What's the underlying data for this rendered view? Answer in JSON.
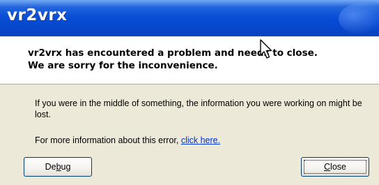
{
  "window": {
    "title": "vr2vrx"
  },
  "header": {
    "line1": "vr2vrx has encountered a problem and needs to close.",
    "line2": "We are sorry for the inconvenience."
  },
  "body": {
    "paragraph1": "If you were in the middle of something, the information you were working on might be lost.",
    "paragraph2_prefix": "For more information about this error, ",
    "paragraph2_link": "click here."
  },
  "buttons": {
    "debug_label_pre": "De",
    "debug_label_u": "b",
    "debug_label_post": "ug",
    "close_label_u": "C",
    "close_label_post": "lose"
  },
  "colors": {
    "titlebar": "#0648cf",
    "window_bg": "#ece9d8",
    "link": "#0033cc"
  },
  "icons": {
    "cursor": "mouse-pointer-icon"
  }
}
